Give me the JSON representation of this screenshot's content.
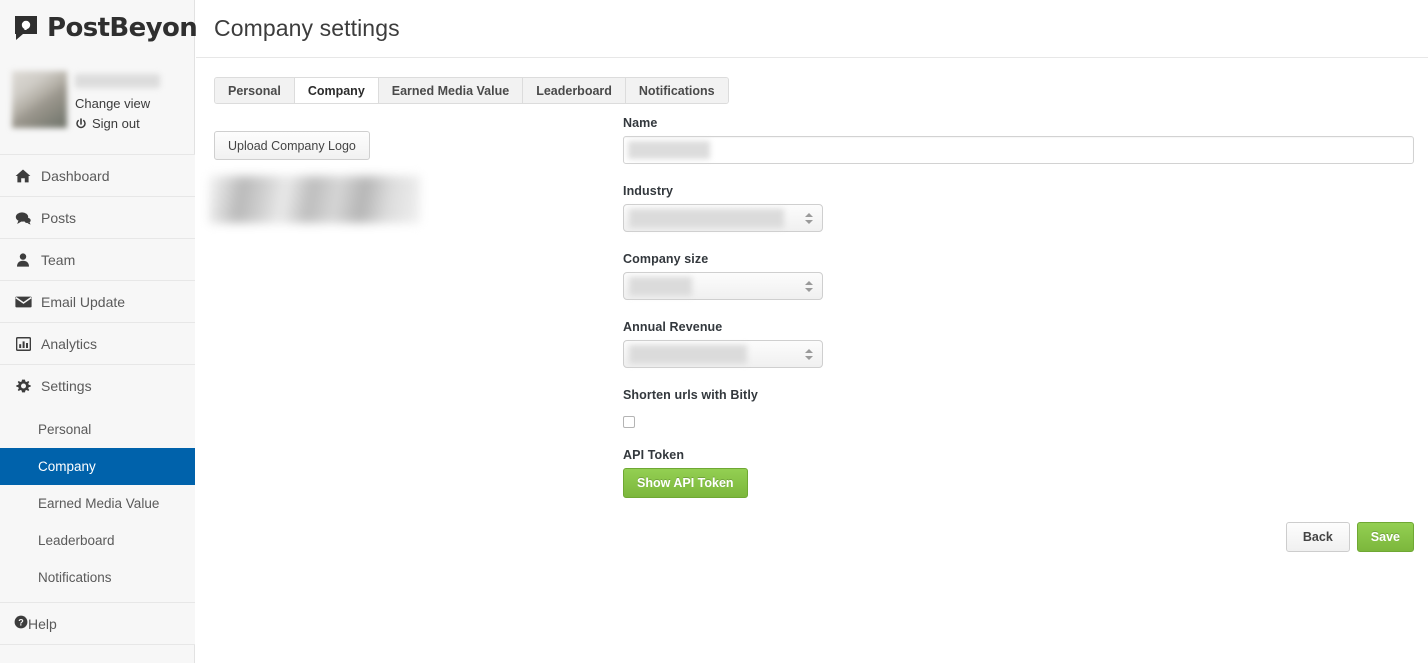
{
  "brand": {
    "name": "PostBeyond",
    "trademark": "™",
    "logo_icon": "postbeyond-speech-bubble-logo"
  },
  "profile": {
    "username": "",
    "change_view_label": "Change view",
    "sign_out_label": "Sign out",
    "sign_out_icon": "power-icon",
    "avatar_icon": "avatar"
  },
  "sidebar": {
    "items": [
      {
        "label": "Dashboard",
        "icon": "home-icon",
        "name": "sidebar-item-dashboard"
      },
      {
        "label": "Posts",
        "icon": "comments-icon",
        "name": "sidebar-item-posts"
      },
      {
        "label": "Team",
        "icon": "user-icon",
        "name": "sidebar-item-team"
      },
      {
        "label": "Email Update",
        "icon": "envelope-icon",
        "name": "sidebar-item-email-update"
      },
      {
        "label": "Analytics",
        "icon": "bar-chart-icon",
        "name": "sidebar-item-analytics"
      },
      {
        "label": "Settings",
        "icon": "gear-icon",
        "name": "sidebar-item-settings"
      }
    ],
    "subitems": [
      {
        "label": "Personal",
        "active": false
      },
      {
        "label": "Company",
        "active": true
      },
      {
        "label": "Earned Media Value",
        "active": false
      },
      {
        "label": "Leaderboard",
        "active": false
      },
      {
        "label": "Notifications",
        "active": false
      }
    ],
    "help": {
      "label": "Help",
      "icon": "question-circle-icon"
    },
    "active_color": "#0062ab"
  },
  "header": {
    "title": "Company settings"
  },
  "tabs": [
    {
      "label": "Personal",
      "active": false
    },
    {
      "label": "Company",
      "active": true
    },
    {
      "label": "Earned Media Value",
      "active": false
    },
    {
      "label": "Leaderboard",
      "active": false
    },
    {
      "label": "Notifications",
      "active": false
    }
  ],
  "logo_panel": {
    "upload_label": "Upload Company Logo"
  },
  "form": {
    "name": {
      "label": "Name",
      "value": "",
      "placeholder": ""
    },
    "industry": {
      "label": "Industry",
      "value": ""
    },
    "company_size": {
      "label": "Company size",
      "value": ""
    },
    "annual_revenue": {
      "label": "Annual Revenue",
      "value": ""
    },
    "bitly": {
      "label": "Shorten urls with Bitly",
      "checked": false
    },
    "api_token": {
      "label": "API Token",
      "button_label": "Show API Token"
    }
  },
  "footer": {
    "back_label": "Back",
    "save_label": "Save",
    "save_color": "#7cb73c"
  }
}
